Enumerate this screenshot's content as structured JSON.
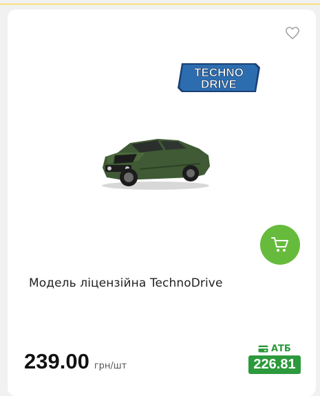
{
  "product": {
    "title": "Модель ліцензійна TechnoDrive",
    "brand_logo_text_line1": "TECHNO",
    "brand_logo_text_line2": "DRIVE",
    "price": "239.00",
    "unit": "грн/шт",
    "loyalty_label": "АТБ",
    "loyalty_price": "226.81",
    "icons": {
      "favorite": "heart-outline-icon",
      "cart": "cart-icon",
      "loyalty": "card-icon"
    }
  },
  "colors": {
    "cart_button": "#66bb3c",
    "loyalty_green": "#2c9a3c",
    "accent_strip": "#fbe27a"
  }
}
